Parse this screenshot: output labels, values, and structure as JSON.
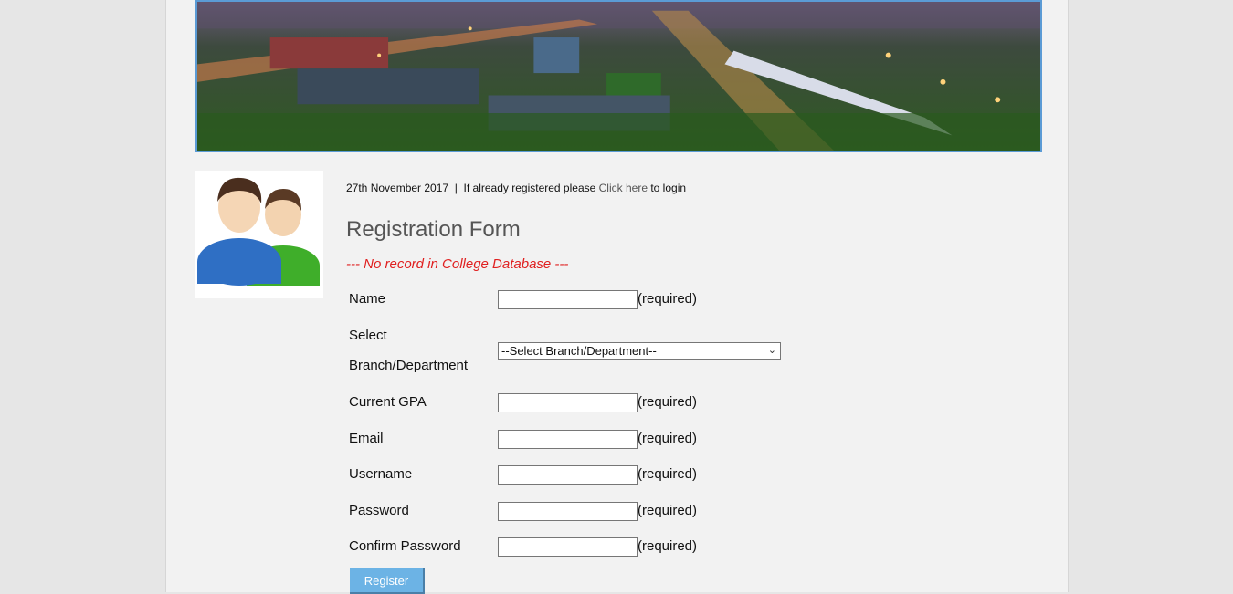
{
  "header": {
    "date": "27th November 2017",
    "separator": "|",
    "login_prefix": "If already registered please",
    "login_link": "Click here",
    "login_suffix": "to login"
  },
  "form": {
    "title": "Registration Form",
    "notice": "--- No record in College Database ---",
    "required_text": "(required)",
    "fields": {
      "name": "Name",
      "branch_line1": "Select",
      "branch_line2": "Branch/Department",
      "branch_selected": "--Select Branch/Department--",
      "gpa": "Current GPA",
      "email": "Email",
      "username": "Username",
      "password": "Password",
      "confirm_password": "Confirm Password"
    },
    "submit_label": "Register"
  },
  "colors": {
    "accent": "#6cb3e5",
    "notice": "#e02020",
    "banner_border": "#5b9bd5"
  },
  "icons": {
    "banner": "campus-night-aerial-image",
    "avatar": "users-icon",
    "select": "chevron-down-icon"
  }
}
